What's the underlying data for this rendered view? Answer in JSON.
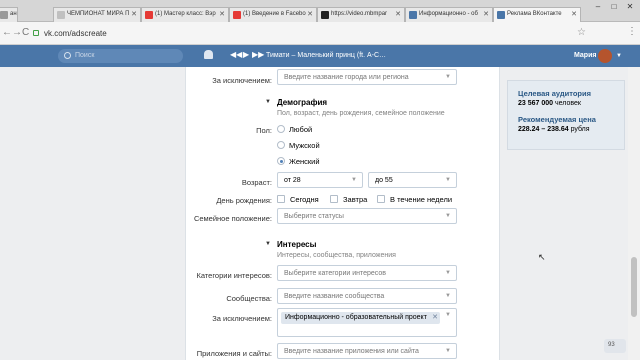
{
  "browser": {
    "tabs": [
      {
        "title": "ан",
        "color": "#999999"
      },
      {
        "title": "ЧЕМПИОНАТ МИРА П",
        "color": "#c0c0c0"
      },
      {
        "title": "(1) Мастер класс: Вэр",
        "color": "#e53935"
      },
      {
        "title": "(1) Введение в Facebo",
        "color": "#e53935"
      },
      {
        "title": "https://video.mbmpar",
        "color": "#222222"
      },
      {
        "title": "Информационно - об",
        "color": "#4a76a8"
      },
      {
        "title": "Реклама ВКонтакте",
        "color": "#4a76a8"
      }
    ],
    "window_controls": [
      "–",
      "□",
      "✕"
    ],
    "url": "vk.com/adscreate",
    "nav": {
      "back": "←",
      "forward": "→",
      "reload": "C"
    }
  },
  "vk_header": {
    "search_placeholder": "Поиск",
    "track": "Тимати – Маленький принц (ft. А-С…",
    "player": {
      "prev": "◀◀",
      "play": "▶",
      "next": "▶▶"
    },
    "user_name": "Мария"
  },
  "form": {
    "exclusion_top": {
      "label": "За исключением:",
      "placeholder": "Введите название города или региона"
    },
    "demography": {
      "title": "Демография",
      "subtitle": "Пол, возраст, день рождения, семейное положение",
      "gender_label": "Пол:",
      "gender_options": [
        "Любой",
        "Мужской",
        "Женский"
      ],
      "gender_selected": "Женский",
      "age_label": "Возраст:",
      "age_from": "от 28",
      "age_to": "до 55",
      "birthday_label": "День рождения:",
      "birthday_options": [
        "Сегодня",
        "Завтра",
        "В течение недели"
      ],
      "family_label": "Семейное положение:",
      "family_placeholder": "Выберите статусы"
    },
    "interests": {
      "title": "Интересы",
      "subtitle": "Интересы, сообщества, приложения",
      "categories_label": "Категории интересов:",
      "categories_placeholder": "Выберите категории интересов",
      "communities_label": "Сообщества:",
      "communities_placeholder": "Введите название сообщества",
      "exclusion_label": "За исключением:",
      "exclusion_token": "Информационно - образовательный проект",
      "apps_label": "Приложения и сайты:",
      "apps_placeholder": "Введите название приложения или сайта"
    }
  },
  "sidebar": {
    "audience_title": "Целевая аудитория",
    "audience_value": "23 567 000",
    "audience_unit": "человек",
    "price_title": "Рекомендуемая цена",
    "price_value": "228.24 – 238.64",
    "price_unit": "рубля"
  },
  "badge": "93",
  "colors": {
    "vk_blue": "#4a76a8",
    "link": "#2a5885",
    "radio_accent": "#5181b8"
  }
}
